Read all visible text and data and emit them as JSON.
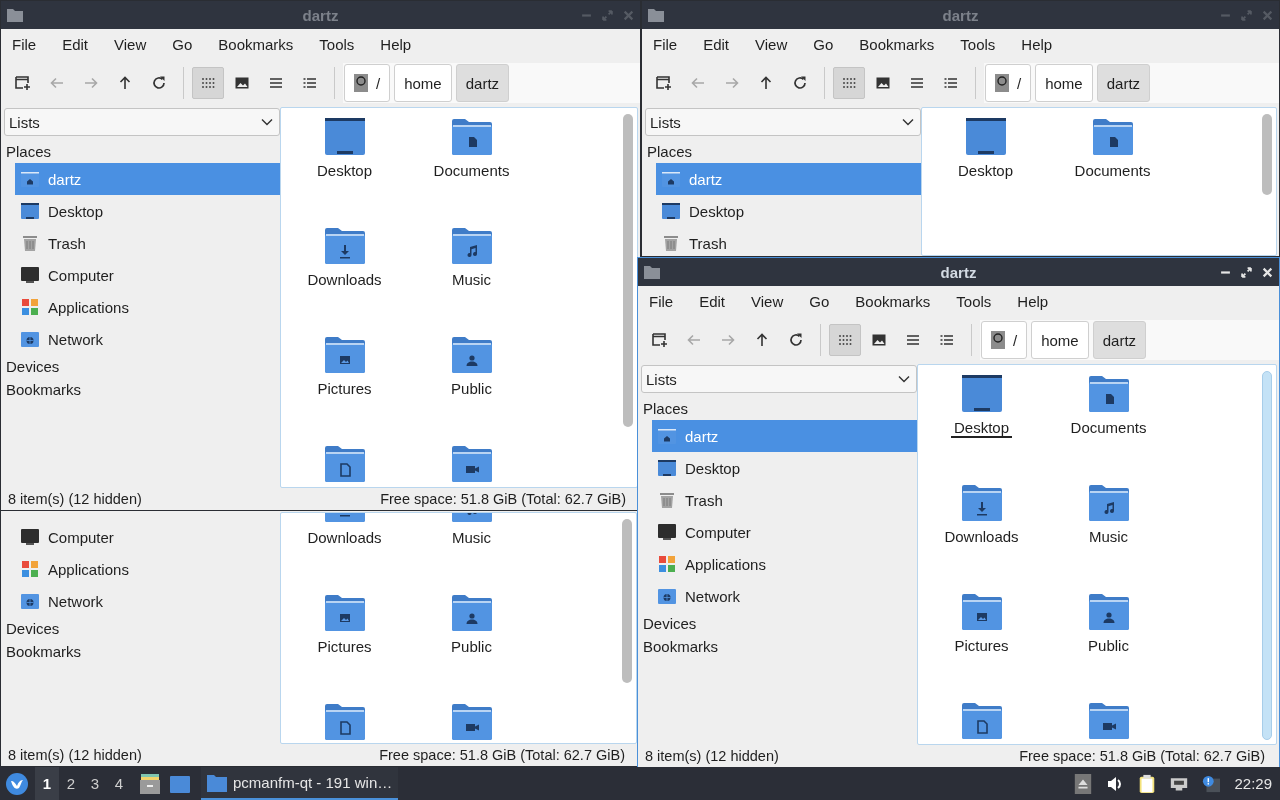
{
  "windows": [
    {
      "title": "dartz",
      "active": false,
      "menu": [
        "File",
        "Edit",
        "View",
        "Go",
        "Bookmarks",
        "Tools",
        "Help"
      ],
      "toolbar": {
        "nav": [
          {
            "kind": "new-window",
            "disabled": false
          },
          {
            "kind": "back",
            "disabled": true
          },
          {
            "kind": "forward",
            "disabled": true
          },
          {
            "kind": "up",
            "disabled": false
          },
          {
            "kind": "reload",
            "disabled": false
          }
        ],
        "views": [
          {
            "kind": "icons",
            "selected": true
          },
          {
            "kind": "thumbnails",
            "selected": false
          },
          {
            "kind": "compact",
            "selected": false
          },
          {
            "kind": "details",
            "selected": false
          }
        ]
      },
      "path": [
        {
          "label": "/",
          "kind": "root",
          "selected": false
        },
        {
          "label": "home",
          "kind": "dir",
          "selected": false
        },
        {
          "label": "dartz",
          "kind": "dir",
          "selected": true
        }
      ],
      "sidebar": {
        "selector": "Lists",
        "sections": [
          {
            "heading": "Places",
            "items": [
              {
                "label": "dartz",
                "kind": "home",
                "selected": true
              },
              {
                "label": "Desktop",
                "kind": "desktop",
                "selected": false
              },
              {
                "label": "Trash",
                "kind": "trash",
                "selected": false
              },
              {
                "label": "Computer",
                "kind": "computer",
                "selected": false
              },
              {
                "label": "Applications",
                "kind": "applications",
                "selected": false
              },
              {
                "label": "Network",
                "kind": "network",
                "selected": false
              }
            ]
          },
          {
            "heading": "Devices"
          },
          {
            "heading": "Bookmarks"
          }
        ]
      },
      "files": [
        {
          "label": "Desktop",
          "kind": "desktop"
        },
        {
          "label": "Documents",
          "kind": "documents"
        },
        {
          "label": "Downloads",
          "kind": "downloads"
        },
        {
          "label": "Music",
          "kind": "music"
        },
        {
          "label": "Pictures",
          "kind": "pictures"
        },
        {
          "label": "Public",
          "kind": "public"
        },
        {
          "kind": "templates"
        },
        {
          "kind": "videos"
        }
      ],
      "status": {
        "items": "8 item(s) (12 hidden)",
        "space": "Free space: 51.8 GiB (Total: 62.7 GiB)"
      }
    },
    {
      "title": "dartz",
      "active": false,
      "menu": [
        "File",
        "Edit",
        "View",
        "Go",
        "Bookmarks",
        "Tools",
        "Help"
      ],
      "toolbar": {
        "nav": [
          {
            "kind": "new-window",
            "disabled": false
          },
          {
            "kind": "back",
            "disabled": true
          },
          {
            "kind": "forward",
            "disabled": true
          },
          {
            "kind": "up",
            "disabled": false
          },
          {
            "kind": "reload",
            "disabled": false
          }
        ],
        "views": [
          {
            "kind": "icons",
            "selected": true
          },
          {
            "kind": "thumbnails",
            "selected": false
          },
          {
            "kind": "compact",
            "selected": false
          },
          {
            "kind": "details",
            "selected": false
          }
        ]
      },
      "path": [
        {
          "label": "/",
          "kind": "root",
          "selected": false
        },
        {
          "label": "home",
          "kind": "dir",
          "selected": false
        },
        {
          "label": "dartz",
          "kind": "dir",
          "selected": true
        }
      ],
      "sidebar": {
        "selector": "Lists",
        "sections": [
          {
            "heading": "Places",
            "items": [
              {
                "label": "dartz",
                "kind": "home",
                "selected": true
              },
              {
                "label": "Desktop",
                "kind": "desktop",
                "selected": false
              },
              {
                "label": "Trash",
                "kind": "trash",
                "selected": false
              }
            ]
          }
        ]
      },
      "files": [
        {
          "label": "Desktop",
          "kind": "desktop"
        },
        {
          "label": "Documents",
          "kind": "documents"
        }
      ]
    },
    {
      "title": "dartz",
      "active": true,
      "menu": [
        "File",
        "Edit",
        "View",
        "Go",
        "Bookmarks",
        "Tools",
        "Help"
      ],
      "toolbar": {
        "nav": [
          {
            "kind": "new-window",
            "disabled": false
          },
          {
            "kind": "back",
            "disabled": true
          },
          {
            "kind": "forward",
            "disabled": true
          },
          {
            "kind": "up",
            "disabled": false
          },
          {
            "kind": "reload",
            "disabled": false
          }
        ],
        "views": [
          {
            "kind": "icons",
            "selected": true
          },
          {
            "kind": "thumbnails",
            "selected": false
          },
          {
            "kind": "compact",
            "selected": false
          },
          {
            "kind": "details",
            "selected": false
          }
        ]
      },
      "path": [
        {
          "label": "/",
          "kind": "root",
          "selected": false
        },
        {
          "label": "home",
          "kind": "dir",
          "selected": false
        },
        {
          "label": "dartz",
          "kind": "dir",
          "selected": true
        }
      ],
      "sidebar": {
        "selector": "Lists",
        "sections": [
          {
            "heading": "Places",
            "items": [
              {
                "label": "dartz",
                "kind": "home",
                "selected": true
              },
              {
                "label": "Desktop",
                "kind": "desktop",
                "selected": false
              },
              {
                "label": "Trash",
                "kind": "trash",
                "selected": false
              },
              {
                "label": "Computer",
                "kind": "computer",
                "selected": false
              },
              {
                "label": "Applications",
                "kind": "applications",
                "selected": false
              },
              {
                "label": "Network",
                "kind": "network",
                "selected": false
              }
            ]
          },
          {
            "heading": "Devices"
          },
          {
            "heading": "Bookmarks"
          }
        ]
      },
      "files": [
        {
          "label": "Desktop",
          "kind": "desktop",
          "focused": true
        },
        {
          "label": "Documents",
          "kind": "documents",
          "focused": false
        },
        {
          "label": "Downloads",
          "kind": "downloads",
          "focused": false
        },
        {
          "label": "Music",
          "kind": "music",
          "focused": false
        },
        {
          "label": "Pictures",
          "kind": "pictures",
          "focused": false
        },
        {
          "label": "Public",
          "kind": "public",
          "focused": false
        },
        {
          "kind": "templates",
          "focused": false
        },
        {
          "kind": "videos",
          "focused": false
        }
      ],
      "status": {
        "items": "8 item(s) (12 hidden)",
        "space": "Free space: 51.8 GiB (Total: 62.7 GiB)"
      }
    }
  ],
  "covered_window": {
    "active": false,
    "sidebar": {
      "sections": [
        {
          "items": [
            {
              "label": "Computer",
              "kind": "computer",
              "selected": false
            },
            {
              "label": "Applications",
              "kind": "applications",
              "selected": false
            },
            {
              "label": "Network",
              "kind": "network",
              "selected": false
            }
          ]
        },
        {
          "heading": "Devices"
        },
        {
          "heading": "Bookmarks"
        }
      ]
    },
    "files": [
      {
        "label": "Downloads",
        "kind": "downloads"
      },
      {
        "label": "Music",
        "kind": "music"
      },
      {
        "label": "Pictures",
        "kind": "pictures"
      },
      {
        "label": "Public",
        "kind": "public"
      },
      {
        "kind": "templates"
      },
      {
        "kind": "videos"
      }
    ],
    "status": {
      "items": "8 item(s) (12 hidden)",
      "space": "Free space: 51.8 GiB (Total: 62.7 GiB)"
    }
  },
  "taskbar": {
    "workspaces": [
      {
        "label": "1",
        "selected": true
      },
      {
        "label": "2",
        "selected": false
      },
      {
        "label": "3",
        "selected": false
      },
      {
        "label": "4",
        "selected": false
      }
    ],
    "launchers": [
      {
        "kind": "file-cabinet"
      },
      {
        "kind": "desktop"
      }
    ],
    "tasks": [
      {
        "label": "pcmanfm-qt - 191 win…",
        "active": true
      }
    ],
    "tray": [
      {
        "kind": "eject"
      },
      {
        "kind": "volume"
      },
      {
        "kind": "clipboard"
      },
      {
        "kind": "network"
      },
      {
        "kind": "notification"
      }
    ],
    "clock": "22:29"
  }
}
